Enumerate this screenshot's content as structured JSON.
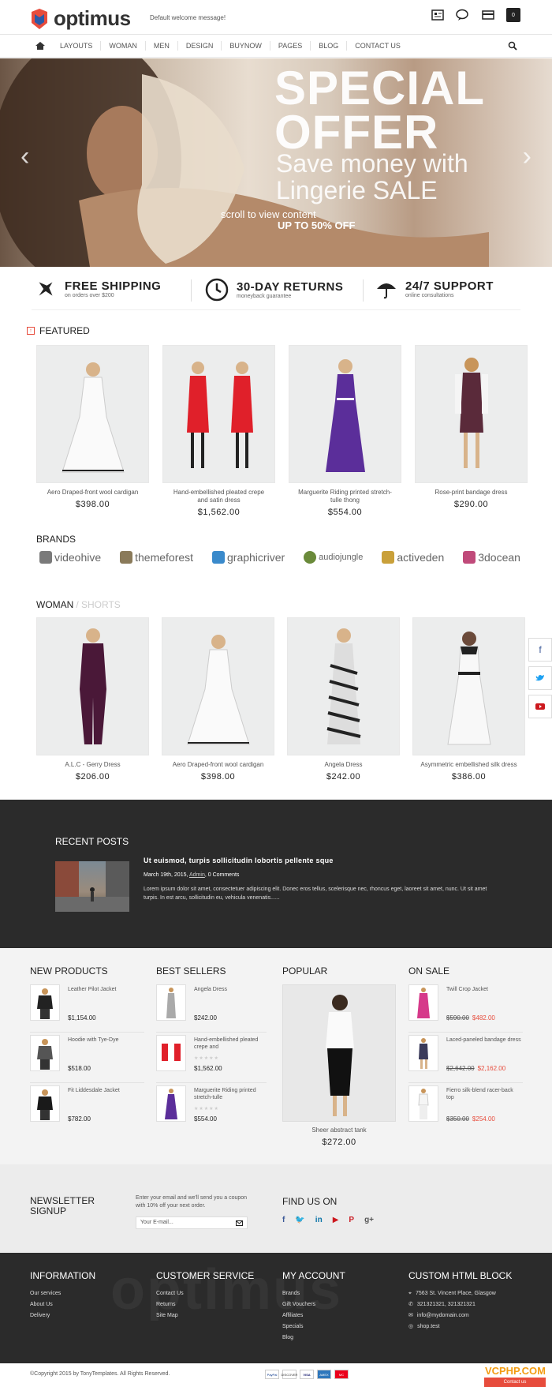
{
  "header": {
    "logo_text": "optimus",
    "welcome": "Default welcome message!",
    "cart_count": "0"
  },
  "nav": {
    "items": [
      "LAYOUTS",
      "WOMAN",
      "MEN",
      "DESIGN",
      "BUYNOW",
      "PAGES",
      "BLOG",
      "CONTACT US"
    ]
  },
  "slider": {
    "line1": "SPECIAL",
    "line2": "OFFER",
    "line3": "Save money with",
    "line4": "Lingerie SALE",
    "scroll": "scroll to view content",
    "offer": "UP TO 50% OFF"
  },
  "features": [
    {
      "title": "FREE SHIPPING",
      "sub": "on orders over $200"
    },
    {
      "title": "30-DAY RETURNS",
      "sub": "moneyback guarantee"
    },
    {
      "title": "24/7 SUPPORT",
      "sub": "online consultations"
    }
  ],
  "featured": {
    "title": "FEATURED",
    "products": [
      {
        "name": "Aero Draped-front wool cardigan",
        "price": "$398.00"
      },
      {
        "name": "Hand-embellished pleated crepe and satin dress",
        "price": "$1,562.00"
      },
      {
        "name": "Marguerite Riding printed stretch-tulle thong",
        "price": "$554.00"
      },
      {
        "name": "Rose-print bandage dress",
        "price": "$290.00"
      }
    ]
  },
  "brands": {
    "title": "BRANDS",
    "items": [
      "videohive",
      "themeforest",
      "graphicriver",
      "audiojungle",
      "activeden",
      "3docean"
    ]
  },
  "woman": {
    "title": "WOMAN",
    "alt_tab": "/ SHORTS",
    "products": [
      {
        "name": "A.L.C - Gerry Dress",
        "price": "$206.00"
      },
      {
        "name": "Aero Draped-front wool cardigan",
        "price": "$398.00"
      },
      {
        "name": "Angela Dress",
        "price": "$242.00"
      },
      {
        "name": "Asymmetric embellished silk dress",
        "price": "$386.00"
      }
    ]
  },
  "recent": {
    "title": "RECENT POSTS",
    "post_title": "Ut euismod, turpis sollicitudin lobortis pellente sque",
    "date": "March 19th, 2015,",
    "author": "Admin",
    "comments": ", 0 Comments",
    "body": "Lorem ipsum dolor sit amet, consectetuer adipiscing elit. Donec eros tellus, scelerisque nec, rhoncus eget, laoreet sit amet, nunc. Ut sit amet turpis. In est arcu, sollicitudin eu, vehicula venenatis......"
  },
  "lists": {
    "new_title": "NEW PRODUCTS",
    "new_items": [
      {
        "name": "Leather Pilot Jacket",
        "price": "$1,154.00"
      },
      {
        "name": "Hoodie with Tye-Dye",
        "price": "$518.00"
      },
      {
        "name": "Fit Liddesdale Jacket",
        "price": "$782.00"
      }
    ],
    "best_title": "BEST SELLERS",
    "best_items": [
      {
        "name": "Angela Dress",
        "price": "$242.00"
      },
      {
        "name": "Hand-embellished pleated crepe and",
        "price": "$1,562.00"
      },
      {
        "name": "Marguerite Riding printed stretch-tulle",
        "price": "$554.00"
      }
    ],
    "popular_title": "POPULAR",
    "popular_name": "Sheer abstract tank",
    "popular_price": "$272.00",
    "sale_title": "ON SALE",
    "sale_items": [
      {
        "name": "Twill Crop Jacket",
        "old": "$590.00",
        "new": "$482.00"
      },
      {
        "name": "Laced-paneled bandage dress",
        "old": "$2,642.00",
        "new": "$2,162.00"
      },
      {
        "name": "Fierro silk-blend racer-back top",
        "old": "$350.00",
        "new": "$254.00"
      }
    ]
  },
  "newsletter": {
    "title1": "NEWSLETTER",
    "title2": "SIGNUP",
    "text": "Enter your email and we'll send you a coupon with 10% off your next order.",
    "placeholder": "Your E-mail...",
    "find_title": "FIND US ON"
  },
  "footer": {
    "watermark": "optimus",
    "info_title": "INFORMATION",
    "info_links": [
      "Our services",
      "About Us",
      "Delivery"
    ],
    "cs_title": "CUSTOMER SERVICE",
    "cs_links": [
      "Contact Us",
      "Returns",
      "Site Map"
    ],
    "acc_title": "MY ACCOUNT",
    "acc_links": [
      "Brands",
      "Gift Vouchers",
      "Affiliates",
      "Specials",
      "Blog"
    ],
    "custom_title": "CUSTOM HTML BLOCK",
    "custom_lines": [
      "7563 St. Vincent Place, Glasgow",
      "321321321, 321321321",
      "info@mydomain.com",
      "shop.test"
    ],
    "copyright": "©Copyright 2015 by TonyTemplates. All Rights Reserved.",
    "payments": [
      "PayPal",
      "DISCOVER",
      "VISA",
      "AMEX",
      "MC"
    ],
    "wm_brand": "VCPHP.COM",
    "wm_btn": "Contact us"
  },
  "colors": {
    "accent": "#e74c3c",
    "dark": "#2b2b2b",
    "light_bg": "#f3f3f3"
  }
}
